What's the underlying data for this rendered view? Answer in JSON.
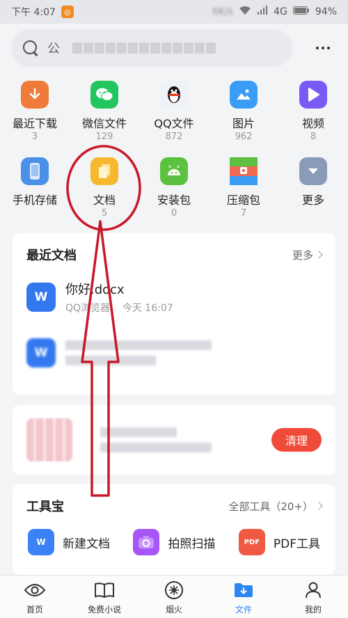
{
  "status_bar": {
    "time": "下午 4:07",
    "speed": "6K/s",
    "network": "4G",
    "battery": "94%"
  },
  "search": {
    "prefix": "公"
  },
  "quick_grid": [
    {
      "label": "最近下载",
      "count": "3",
      "icon": "download-icon",
      "color": "#f07a3a"
    },
    {
      "label": "微信文件",
      "count": "129",
      "icon": "wechat-icon",
      "color": "#22c55e"
    },
    {
      "label": "QQ文件",
      "count": "872",
      "icon": "qq-penguin-icon",
      "color": "#eef2f7"
    },
    {
      "label": "图片",
      "count": "962",
      "icon": "image-icon",
      "color": "#3b9cf5"
    },
    {
      "label": "视频",
      "count": "8",
      "icon": "play-icon",
      "color": "#7a5af5"
    },
    {
      "label": "手机存储",
      "count": "",
      "icon": "phone-icon",
      "color": "#4a90e8"
    },
    {
      "label": "文档",
      "count": "5",
      "icon": "document-icon",
      "color": "#f5b82e"
    },
    {
      "label": "安装包",
      "count": "0",
      "icon": "android-icon",
      "color": "#5cc13f"
    },
    {
      "label": "压缩包",
      "count": "7",
      "icon": "zip-icon",
      "color": "#f06a52"
    },
    {
      "label": "更多",
      "count": "",
      "icon": "chevron-down-icon",
      "color": "#8a9bb8"
    }
  ],
  "recent_docs": {
    "title": "最近文档",
    "more": "更多",
    "items": [
      {
        "name": "你好.docx",
        "source": "QQ浏览器",
        "time": "今天 16:07",
        "icon_letter": "W"
      },
      {
        "name": "",
        "source": "",
        "time": "",
        "icon_letter": "W"
      }
    ]
  },
  "cleaner": {
    "button": "清理"
  },
  "toolbox": {
    "title": "工具宝",
    "all_tools": "全部工具（20+）",
    "tools": [
      {
        "label": "新建文档",
        "icon": "new-doc-icon",
        "color": "#3b82f6",
        "glyph": "W"
      },
      {
        "label": "拍照扫描",
        "icon": "camera-icon",
        "color": "#a855f7",
        "glyph": ""
      },
      {
        "label": "PDF工具",
        "icon": "pdf-icon",
        "color": "#f05a44",
        "glyph": "PDF"
      }
    ]
  },
  "bottom_nav": [
    {
      "label": "首页",
      "icon": "eye-icon",
      "active": false
    },
    {
      "label": "免费小说",
      "icon": "book-icon",
      "active": false
    },
    {
      "label": "烟火",
      "icon": "firework-icon",
      "active": false
    },
    {
      "label": "文件",
      "icon": "folder-icon",
      "active": true
    },
    {
      "label": "我的",
      "icon": "profile-icon",
      "active": false
    }
  ],
  "colors": {
    "accent": "#2e86f0",
    "clean_button": "#f04a3a",
    "annotation": "#c8182a"
  }
}
